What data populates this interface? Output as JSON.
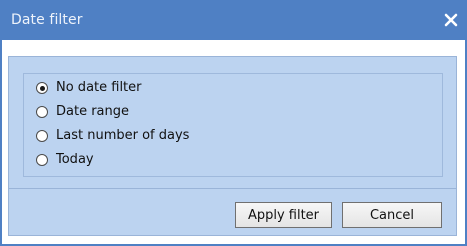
{
  "window": {
    "title": "Date filter",
    "close_icon": "close-icon",
    "accent_color": "#4f80c4",
    "panel_color": "#bcd3f0"
  },
  "options": {
    "selected": "No date filter",
    "items": [
      {
        "label": "No date filter",
        "checked": true
      },
      {
        "label": "Date range",
        "checked": false
      },
      {
        "label": "Last number of days",
        "checked": false
      },
      {
        "label": "Today",
        "checked": false
      }
    ]
  },
  "buttons": {
    "apply_label": "Apply filter",
    "cancel_label": "Cancel"
  }
}
